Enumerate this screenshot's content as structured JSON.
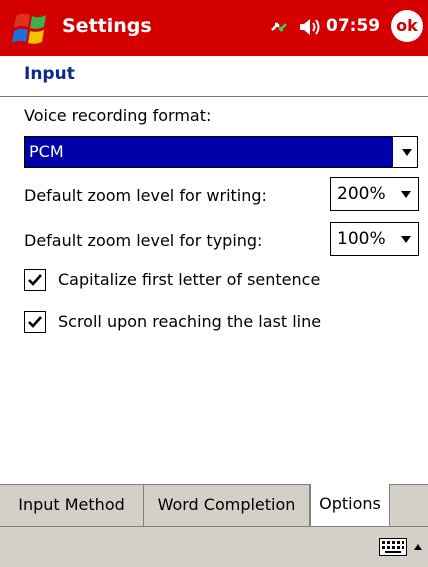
{
  "titlebar": {
    "title": "Settings",
    "clock": "07:59",
    "ok_label": "ok",
    "start_icon": "windows-flag-icon",
    "connectivity_icon": "connectivity-icon",
    "volume_icon": "speaker-icon",
    "bg_color": "#d40000"
  },
  "section": {
    "title": "Input"
  },
  "form": {
    "voice_label": "Voice recording format:",
    "voice_value": "PCM",
    "zoom_writing_label": "Default zoom level for writing:",
    "zoom_writing_value": "200%",
    "zoom_typing_label": "Default zoom level for typing:",
    "zoom_typing_value": "100%",
    "capitalize_label": "Capitalize first letter of sentence",
    "capitalize_checked": true,
    "scroll_label": "Scroll upon reaching the last line",
    "scroll_checked": true
  },
  "tabs": [
    {
      "label": "Input Method",
      "selected": false
    },
    {
      "label": "Word Completion",
      "selected": false
    },
    {
      "label": "Options",
      "selected": true
    }
  ],
  "menubar": {
    "keyboard_icon": "keyboard-icon",
    "arrow_icon": "up-arrow-icon"
  }
}
